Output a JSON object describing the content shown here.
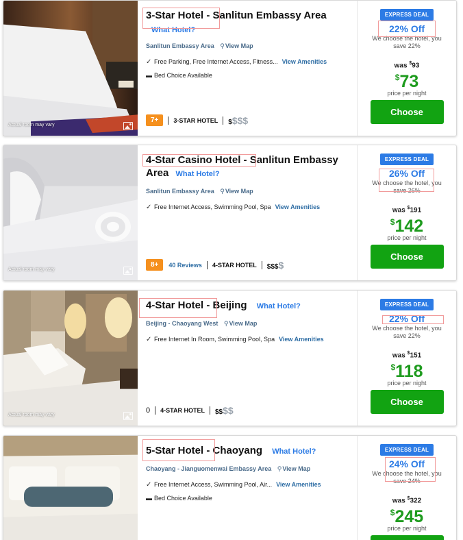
{
  "common": {
    "what_hotel": "What Hotel?",
    "view_map": "View Map",
    "view_amenities": "View Amenities",
    "photo_caption": "Actual room may vary",
    "express_deal": "EXPRESS DEAL",
    "choose_note": "We choose the hotel, you",
    "was_label": "was",
    "currency": "$",
    "per_night": "price per night",
    "choose_label": "Choose"
  },
  "hotels": [
    {
      "title": "3-Star Hotel - Sanlitun Embassy Area",
      "location": "Sanlitun Embassy Area",
      "amenities": "Free Parking, Free Internet Access, Fitness...",
      "bed": "Bed Choice Available",
      "score": "7+",
      "reviews": "",
      "star_label": "3-STAR HOTEL",
      "dollars_on": "$",
      "dollars_off": "$$$",
      "discount": "22% Off",
      "save": "save 22%",
      "was": "93",
      "now": "73"
    },
    {
      "title": "4-Star Casino Hotel - Sanlitun Embassy Area",
      "location": "Sanlitun Embassy Area",
      "amenities": "Free Internet Access, Swimming Pool, Spa",
      "bed": "",
      "score": "8+",
      "reviews": "40 Reviews",
      "star_label": "4-STAR HOTEL",
      "dollars_on": "$$$",
      "dollars_off": "$",
      "discount": "26% Off",
      "save": "save 26%",
      "was": "191",
      "now": "142"
    },
    {
      "title": "4-Star Hotel - Beijing",
      "location": "Beijing - Chaoyang West",
      "amenities": "Free Internet In Room, Swimming Pool, Spa",
      "bed": "",
      "score": "0",
      "reviews": "",
      "star_label": "4-STAR HOTEL",
      "dollars_on": "$$",
      "dollars_off": "$$",
      "discount": "22% Off",
      "save": "save 22%",
      "was": "151",
      "now": "118"
    },
    {
      "title": "5-Star Hotel - Chaoyang",
      "location": "Chaoyang - Jianguomenwai Embassy Area",
      "amenities": "Free Internet Access, Swimming Pool, Air...",
      "bed": "Bed Choice Available",
      "score": "",
      "reviews": "",
      "star_label": "",
      "dollars_on": "",
      "dollars_off": "",
      "discount": "24% Off",
      "save": "save 24%",
      "was": "322",
      "now": "245"
    }
  ]
}
